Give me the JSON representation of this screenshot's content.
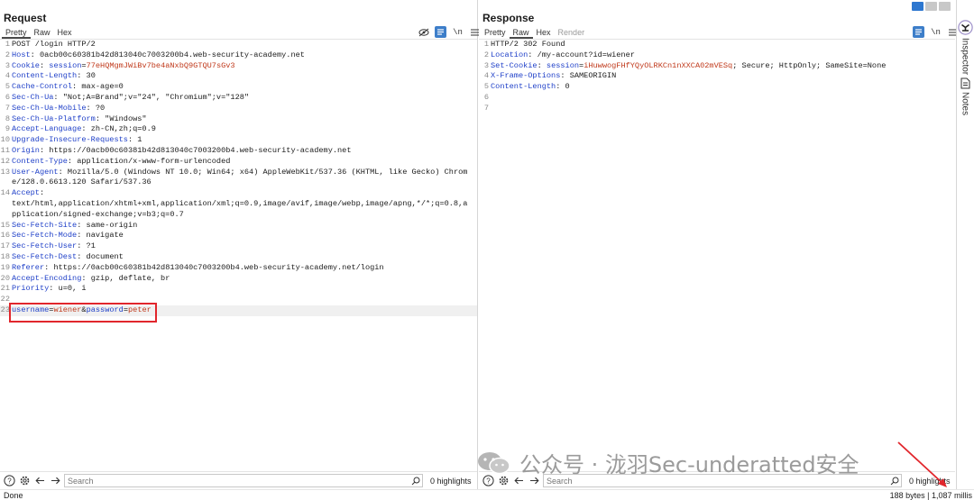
{
  "request": {
    "title": "Request",
    "tabs": [
      "Pretty",
      "Raw",
      "Hex"
    ],
    "active_tab": "Pretty",
    "newline_toggle": "\\n",
    "lines": [
      {
        "n": "1",
        "type": "plain",
        "text": "POST /login HTTP/2"
      },
      {
        "n": "2",
        "type": "header",
        "name": "Host",
        "value": " 0acb00c60381b42d813040c7003200b4.web-security-academy.net"
      },
      {
        "n": "3",
        "type": "cookie",
        "name": "Cookie",
        "key": "session",
        "value": "77eHQMgmJWiBv7be4aNxbQ9GTQU7sGv3"
      },
      {
        "n": "4",
        "type": "header",
        "name": "Content-Length",
        "value": " 30"
      },
      {
        "n": "5",
        "type": "header",
        "name": "Cache-Control",
        "value": " max-age=0"
      },
      {
        "n": "6",
        "type": "header",
        "name": "Sec-Ch-Ua",
        "value": " \"Not;A=Brand\";v=\"24\", \"Chromium\";v=\"128\""
      },
      {
        "n": "7",
        "type": "header",
        "name": "Sec-Ch-Ua-Mobile",
        "value": " ?0"
      },
      {
        "n": "8",
        "type": "header",
        "name": "Sec-Ch-Ua-Platform",
        "value": " \"Windows\""
      },
      {
        "n": "9",
        "type": "header",
        "name": "Accept-Language",
        "value": " zh-CN,zh;q=0.9"
      },
      {
        "n": "10",
        "type": "header",
        "name": "Upgrade-Insecure-Requests",
        "value": " 1"
      },
      {
        "n": "11",
        "type": "header",
        "name": "Origin",
        "value": " https://0acb00c60381b42d813040c7003200b4.web-security-academy.net"
      },
      {
        "n": "12",
        "type": "header",
        "name": "Content-Type",
        "value": " application/x-www-form-urlencoded"
      },
      {
        "n": "13",
        "type": "header",
        "name": "User-Agent",
        "value": " Mozilla/5.0 (Windows NT 10.0; Win64; x64) AppleWebKit/537.36 (KHTML, like Gecko) Chrome/128.0.6613.120 Safari/537.36"
      },
      {
        "n": "14",
        "type": "header",
        "name": "Accept",
        "value": "\ntext/html,application/xhtml+xml,application/xml;q=0.9,image/avif,image/webp,image/apng,*/*;q=0.8,application/signed-exchange;v=b3;q=0.7"
      },
      {
        "n": "15",
        "type": "header",
        "name": "Sec-Fetch-Site",
        "value": " same-origin"
      },
      {
        "n": "16",
        "type": "header",
        "name": "Sec-Fetch-Mode",
        "value": " navigate"
      },
      {
        "n": "17",
        "type": "header",
        "name": "Sec-Fetch-User",
        "value": " ?1"
      },
      {
        "n": "18",
        "type": "header",
        "name": "Sec-Fetch-Dest",
        "value": " document"
      },
      {
        "n": "19",
        "type": "header",
        "name": "Referer",
        "value": " https://0acb00c60381b42d813040c7003200b4.web-security-academy.net/login"
      },
      {
        "n": "20",
        "type": "header",
        "name": "Accept-Encoding",
        "value": " gzip, deflate, br"
      },
      {
        "n": "21",
        "type": "header",
        "name": "Priority",
        "value": " u=0, i"
      },
      {
        "n": "22",
        "type": "plain",
        "text": ""
      },
      {
        "n": "23",
        "type": "body",
        "params": [
          {
            "key": "username",
            "value": "wiener"
          },
          {
            "key": "password",
            "value": "peter"
          }
        ]
      }
    ],
    "search_placeholder": "Search",
    "highlights": "0 highlights"
  },
  "response": {
    "title": "Response",
    "tabs": [
      "Pretty",
      "Raw",
      "Hex",
      "Render"
    ],
    "active_tab": "Raw",
    "newline_toggle": "\\n",
    "lines": [
      {
        "n": "1",
        "type": "plain",
        "text": "HTTP/2 302 Found"
      },
      {
        "n": "2",
        "type": "header",
        "name": "Location",
        "value": " /my-account?id=wiener"
      },
      {
        "n": "3",
        "type": "setcookie",
        "name": "Set-Cookie",
        "key": "session",
        "value": "iHuwwogFHfYQyOLRKCn1nXXCA02mVESq",
        "rest": "; Secure; HttpOnly; SameSite=None"
      },
      {
        "n": "4",
        "type": "header",
        "name": "X-Frame-Options",
        "value": " SAMEORIGIN"
      },
      {
        "n": "5",
        "type": "header",
        "name": "Content-Length",
        "value": " 0"
      },
      {
        "n": "6",
        "type": "plain",
        "text": ""
      },
      {
        "n": "7",
        "type": "plain",
        "text": ""
      }
    ],
    "search_placeholder": "Search",
    "highlights": "0 highlights"
  },
  "side_tabs": {
    "inspector": "Inspector",
    "notes": "Notes"
  },
  "status": {
    "left": "Done",
    "right": "188 bytes | 1,087 millis"
  },
  "watermark": "公众号 · 泷羽Sec-underatted安全",
  "colors": {
    "header_name": "#1e3fc8",
    "param_value": "#c0391b",
    "accent": "#2d77d0",
    "annotation_red": "#e1262c"
  }
}
